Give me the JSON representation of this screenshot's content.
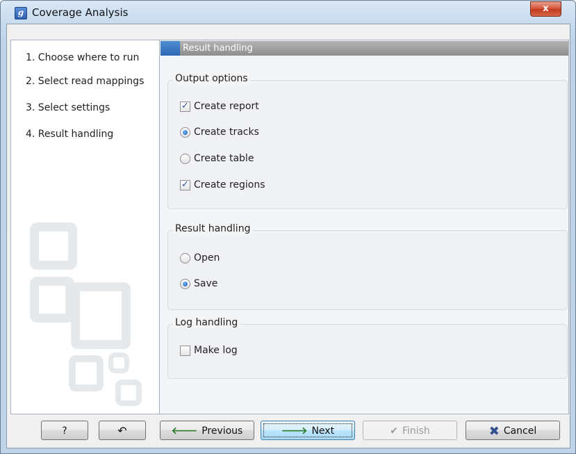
{
  "window": {
    "title": "Coverage Analysis",
    "app_icon": "g",
    "close_label": "x"
  },
  "steps": [
    "1.  Choose where to run",
    "2.  Select read mappings",
    "3.  Select settings",
    "4.  Result handling"
  ],
  "panel": {
    "header": "Result handling",
    "output_options": {
      "title": "Output options",
      "items": [
        {
          "label": "Create report",
          "type": "checkbox",
          "checked": true
        },
        {
          "label": "Create tracks",
          "type": "radio",
          "checked": true
        },
        {
          "label": "Create table",
          "type": "radio",
          "checked": false
        },
        {
          "label": "Create regions",
          "type": "checkbox",
          "checked": true
        }
      ]
    },
    "result_handling": {
      "title": "Result handling",
      "items": [
        {
          "label": "Open",
          "type": "radio",
          "checked": false
        },
        {
          "label": "Save",
          "type": "radio",
          "checked": true
        }
      ]
    },
    "log_handling": {
      "title": "Log handling",
      "items": [
        {
          "label": "Make log",
          "type": "checkbox",
          "checked": false
        }
      ]
    }
  },
  "buttons": {
    "help": "?",
    "reset_icon": "reset-icon",
    "previous": "Previous",
    "next": "Next",
    "finish": "Finish",
    "cancel": "Cancel"
  },
  "colors": {
    "accent": "#2d66b3",
    "header": "#9a9a9a",
    "close": "#c23b1f"
  }
}
